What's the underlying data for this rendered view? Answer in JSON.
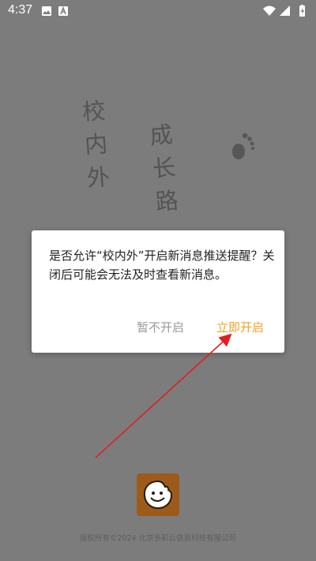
{
  "status_bar": {
    "time": "4:37",
    "icons_left": [
      "gallery-icon",
      "a-icon"
    ],
    "icons_right": [
      "wifi-icon",
      "signal-icon",
      "battery-icon"
    ]
  },
  "splash": {
    "slogan_line1": "校内外",
    "slogan_line2": "成长路",
    "copyright": "版权所有©2024 北京多彩云信息科技有限公司"
  },
  "dialog": {
    "message": "是否允许“校内外”开启新消息推送提醒？关闭后可能会无法及时查看新消息。",
    "deny_label": "暂不开启",
    "allow_label": "立即开启"
  },
  "colors": {
    "background": "#7c7c7c",
    "accent": "#f0a224",
    "arrow": "#e02020",
    "logo": "#9c5b1b"
  }
}
